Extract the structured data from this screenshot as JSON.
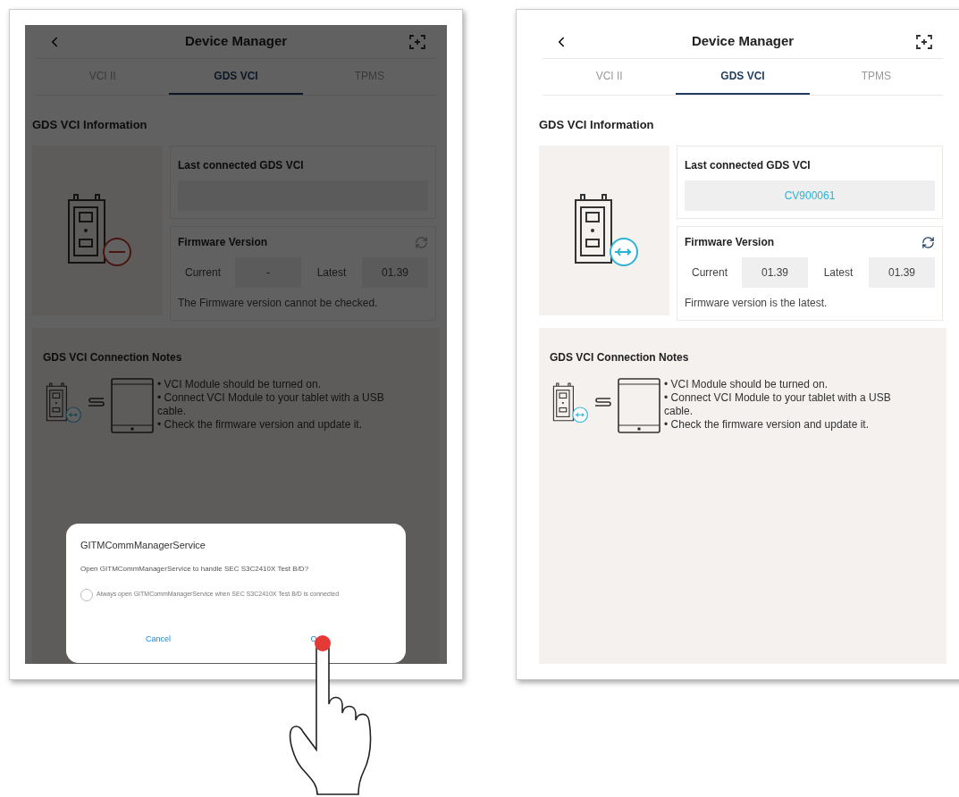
{
  "screens": [
    {
      "dimmed": true,
      "title": "Device Manager",
      "tabs": [
        {
          "label": "VCI II",
          "selected": false
        },
        {
          "label": "GDS VCI",
          "selected": true
        },
        {
          "label": "TPMS",
          "selected": false
        }
      ],
      "info": {
        "title": "GDS VCI Information",
        "connected": false,
        "last_connected_label": "Last connected GDS VCI",
        "firmware_label": "Firmware Version",
        "current_label": "Current",
        "current_value": "-",
        "latest_label": "Latest",
        "latest_value": "01.39",
        "status": "The Firmware version cannot be checked."
      },
      "notes": {
        "title": "GDS VCI Connection Notes",
        "items": [
          "• VCI Module should be turned on.",
          "• Connect VCI Module to your tablet with a USB cable.",
          "• Check the firmware version and update it."
        ]
      },
      "dialog": {
        "title": "GITMCommManagerService",
        "message": "Open GITMCommManagerService to handle SEC S3C2410X Test B/D?",
        "option": {
          "label": "Always open GITMCommManagerService when SEC S3C2410X Test B/D is connected",
          "checked": false
        },
        "buttons": [
          "Cancel",
          "O"
        ]
      }
    },
    {
      "dimmed": false,
      "title": "Device Manager",
      "tabs": [
        {
          "label": "VCI II",
          "selected": false
        },
        {
          "label": "GDS VCI",
          "selected": true
        },
        {
          "label": "TPMS",
          "selected": false
        }
      ],
      "info": {
        "title": "GDS VCI Information",
        "connected": true,
        "last_connected_label": "Last connected GDS VCI",
        "last_connected_value": "CV900061",
        "firmware_label": "Firmware Version",
        "current_label": "Current",
        "current_value": "01.39",
        "latest_label": "Latest",
        "latest_value": "01.39",
        "status": "Firmware version is the latest."
      },
      "notes": {
        "title": "GDS VCI Connection Notes",
        "items": [
          "• VCI Module should be turned on.",
          "• Connect VCI Module to your tablet with a USB cable.",
          "• Check the firmware version and update it."
        ]
      }
    }
  ]
}
